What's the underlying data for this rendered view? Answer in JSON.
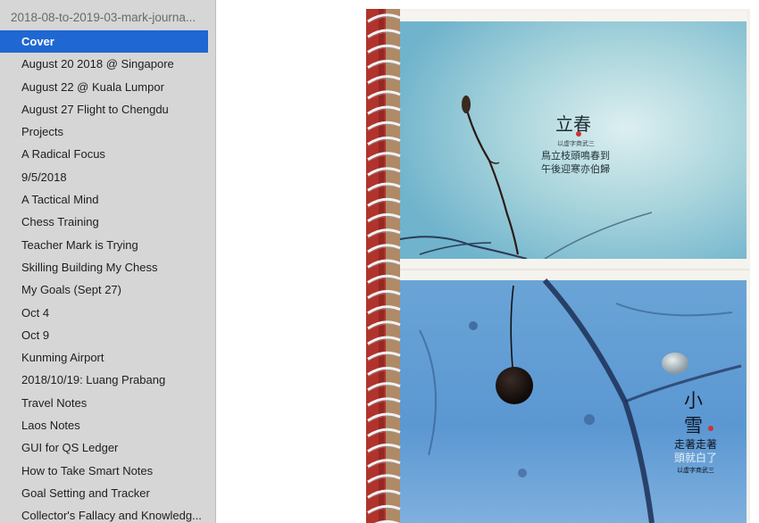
{
  "sidebar": {
    "title": "2018-08-to-2019-03-mark-journa...",
    "items": [
      {
        "label": "Cover",
        "selected": true
      },
      {
        "label": "August 20 2018 @ Singapore"
      },
      {
        "label": "August 22 @ Kuala Lumpor"
      },
      {
        "label": "August 27 Flight to Chengdu"
      },
      {
        "label": "Projects"
      },
      {
        "label": "A Radical Focus"
      },
      {
        "label": "9/5/2018"
      },
      {
        "label": "A Tactical Mind"
      },
      {
        "label": "Chess Training"
      },
      {
        "label": "Teacher Mark is Trying"
      },
      {
        "label": "Skilling Building My Chess"
      },
      {
        "label": "My Goals (Sept 27)"
      },
      {
        "label": "Oct 4"
      },
      {
        "label": "Oct 9"
      },
      {
        "label": "Kunming Airport"
      },
      {
        "label": "2018/10/19: Luang Prabang"
      },
      {
        "label": "Travel Notes"
      },
      {
        "label": "Laos Notes"
      },
      {
        "label": "GUI for QS Ledger"
      },
      {
        "label": "How to Take Smart Notes"
      },
      {
        "label": "Goal Setting and Tracker"
      },
      {
        "label": "Collector's Fallacy and Knowledg..."
      }
    ]
  },
  "cover": {
    "top_title": "立春",
    "top_subtitle": "以虚字商武三",
    "top_poem_line1": "鳥立枝頭鳴春到",
    "top_poem_line2": "午後迎寒亦伯歸",
    "bottom_title_1": "小",
    "bottom_title_2": "雪",
    "bottom_poem_line1": "走著走著",
    "bottom_poem_line2": "頭就白了",
    "bottom_subtitle": "以虚字商武三"
  },
  "colors": {
    "selection": "#1f67d2",
    "sidebar_bg": "#d6d6d6",
    "spiral_red": "#b2322c",
    "top_panel": "#9fd0dc",
    "bottom_panel": "#5d9bd6"
  }
}
